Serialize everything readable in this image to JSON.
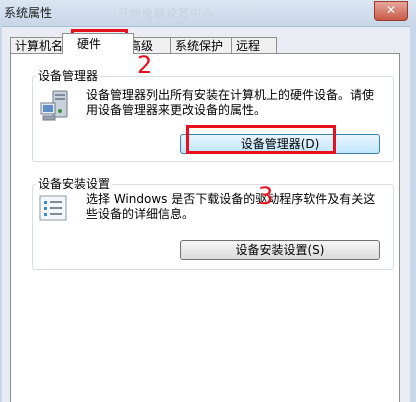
{
  "window": {
    "title": "系统属性",
    "ghost_title": "开始电脑设置中心",
    "close_glyph": "✕"
  },
  "tabs": [
    {
      "label": "计算机名"
    },
    {
      "label": "硬件"
    },
    {
      "label": "高级"
    },
    {
      "label": "系统保护"
    },
    {
      "label": "远程"
    }
  ],
  "device_manager": {
    "group_title": "设备管理器",
    "description_line1": "设备管理器列出所有安装在计算机上的硬件设备。请使",
    "description_line2": "用设备管理器来更改设备的属性。",
    "button_label": "设备管理器(D)"
  },
  "device_install": {
    "group_title": "设备安装设置",
    "description_line1": "选择 Windows 是否下载设备的驱动程序软件及有关这",
    "description_line2": "些设备的详细信息。",
    "button_label": "设备安装设置(S)"
  },
  "annotations": {
    "marker_2": "2",
    "marker_3": "3",
    "color": "#e8101c"
  },
  "icons": {
    "device_manager": "computer-device-icon",
    "device_install": "settings-list-icon"
  }
}
